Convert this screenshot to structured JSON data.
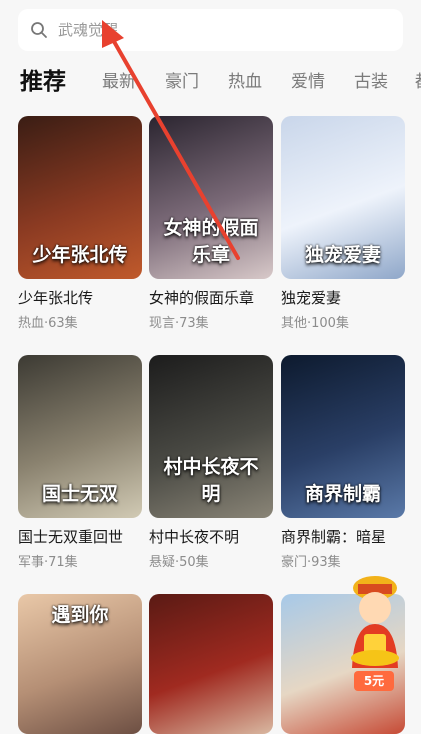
{
  "search": {
    "placeholder": "武魂觉醒",
    "icon": "search-icon"
  },
  "tabs": [
    {
      "label": "推荐",
      "active": true
    },
    {
      "label": "最新",
      "active": false
    },
    {
      "label": "豪门",
      "active": false
    },
    {
      "label": "热血",
      "active": false
    },
    {
      "label": "爱情",
      "active": false
    },
    {
      "label": "古装",
      "active": false
    },
    {
      "label": "都",
      "active": false
    }
  ],
  "cards": [
    {
      "title": "少年张北传",
      "meta": "热血·63集",
      "poster_text": "少年张北传",
      "colors": [
        "#3a1d14",
        "#8a3a22",
        "#c05a2c"
      ]
    },
    {
      "title": "女神的假面乐章",
      "meta": "现言·73集",
      "poster_text": "女神的假面乐章",
      "colors": [
        "#2b2530",
        "#7b6a78",
        "#d8c9c9"
      ]
    },
    {
      "title": "独宠爱妻",
      "meta": "其他·100集",
      "poster_text": "独宠爱妻",
      "colors": [
        "#c9d6ea",
        "#eef3fb",
        "#8fa7c9"
      ]
    },
    {
      "title": "国士无双重回世",
      "meta": "军事·71集",
      "poster_text": "国士无双",
      "colors": [
        "#3c3a33",
        "#8a826f",
        "#d1cab4"
      ]
    },
    {
      "title": "村中长夜不明",
      "meta": "悬疑·50集",
      "poster_text": "村中长夜不明",
      "colors": [
        "#1c1c1c",
        "#4a4a44",
        "#8a8577"
      ]
    },
    {
      "title": "商界制霸：暗星",
      "meta": "豪门·93集",
      "poster_text": "商界制霸",
      "colors": [
        "#0d1a2e",
        "#2a3f66",
        "#5a79a8"
      ]
    },
    {
      "title": "",
      "meta": "",
      "poster_text": "遇到你",
      "colors": [
        "#e9c8a8",
        "#b58f75",
        "#6d4f43"
      ]
    },
    {
      "title": "",
      "meta": "",
      "poster_text": "",
      "colors": [
        "#5a1a14",
        "#a02a20",
        "#d9b8a1"
      ]
    },
    {
      "title": "",
      "meta": "",
      "poster_text": "",
      "colors": [
        "#a7c9e8",
        "#e6d7c4",
        "#c64a35"
      ]
    }
  ],
  "badge": {
    "label": "5元"
  },
  "colors": {
    "accent_red": "#e8412f",
    "background": "#f7f7f7"
  }
}
